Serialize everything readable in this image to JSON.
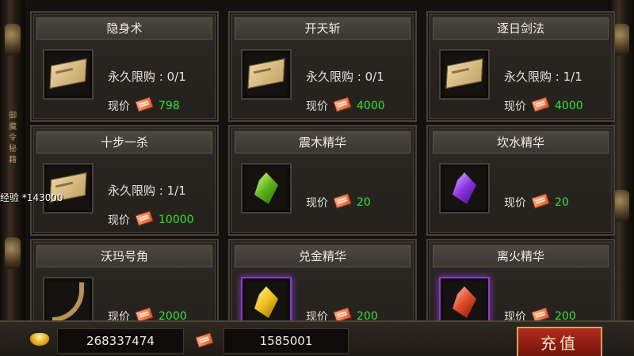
{
  "shop": {
    "limit_prefix": "永久限购 : ",
    "price_label": "现价",
    "items": [
      {
        "name": "隐身术",
        "limit": "0/1",
        "price": "798",
        "icon": "book-icon"
      },
      {
        "name": "开天斩",
        "limit": "0/1",
        "price": "4000",
        "icon": "book-icon"
      },
      {
        "name": "逐日剑法",
        "limit": "1/1",
        "price": "4000",
        "icon": "book-icon"
      },
      {
        "name": "十步一杀",
        "limit": "1/1",
        "price": "10000",
        "icon": "book-icon"
      },
      {
        "name": "震木精华",
        "limit": "",
        "price": "20",
        "icon": "green-crystal-icon"
      },
      {
        "name": "坎水精华",
        "limit": "",
        "price": "20",
        "icon": "purple-crystal-icon"
      },
      {
        "name": "沃玛号角",
        "limit": "",
        "price": "2000",
        "icon": "horn-icon"
      },
      {
        "name": "兑金精华",
        "limit": "",
        "price": "200",
        "icon": "gold-crystal-icon"
      },
      {
        "name": "离火精华",
        "limit": "",
        "price": "200",
        "icon": "red-crystal-icon"
      }
    ]
  },
  "exp_popup": "经验 *143000",
  "side_runes": "御\n魔\n令\n秘\n籍",
  "wallet": {
    "gold": "268337474",
    "coupons": "1585001",
    "charge_label": "充值"
  },
  "colors": {
    "price_value": "#39e03a",
    "title_bar": "#3f3b35",
    "charge_button": "#8e1b10"
  }
}
